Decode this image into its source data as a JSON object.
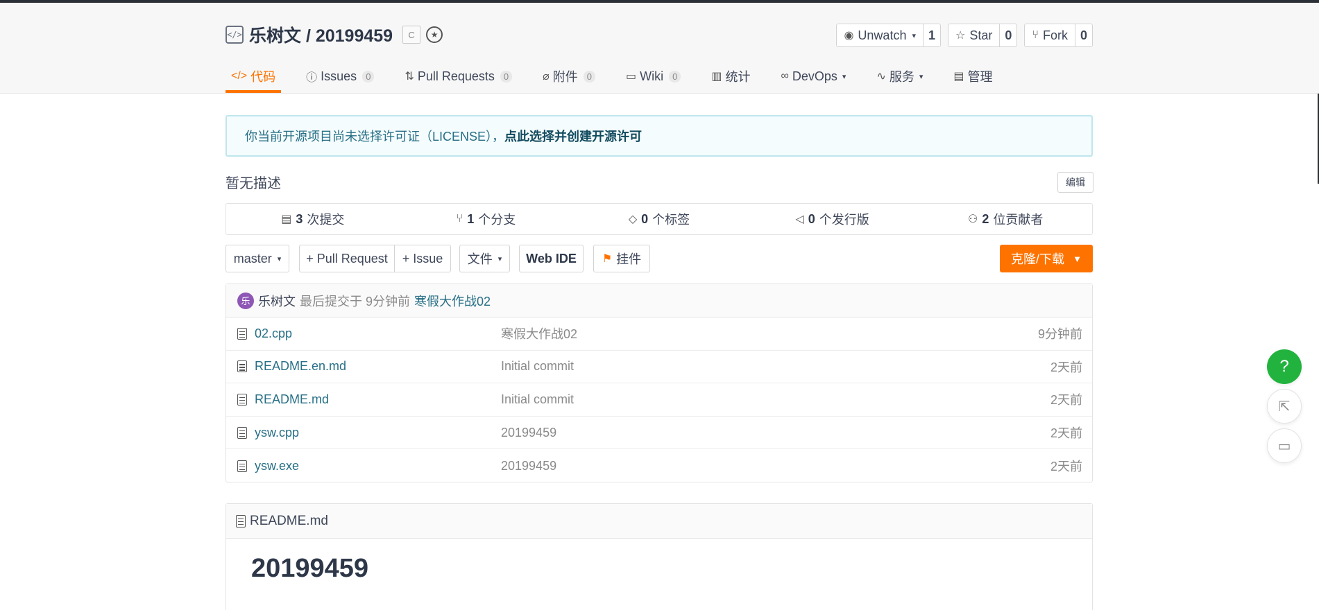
{
  "repo": {
    "owner_slash_name": "乐树文 / 20199459",
    "lang_badge": "C"
  },
  "actions": {
    "unwatch": {
      "label": "Unwatch",
      "count": "1"
    },
    "star": {
      "label": "Star",
      "count": "0"
    },
    "fork": {
      "label": "Fork",
      "count": "0"
    }
  },
  "tabs": [
    {
      "label": "代码"
    },
    {
      "label": "Issues",
      "count": "0"
    },
    {
      "label": "Pull Requests",
      "count": "0"
    },
    {
      "label": "附件",
      "count": "0"
    },
    {
      "label": "Wiki",
      "count": "0"
    },
    {
      "label": "统计"
    },
    {
      "label": "DevOps"
    },
    {
      "label": "服务"
    },
    {
      "label": "管理"
    }
  ],
  "license": {
    "text": "你当前开源项目尚未选择许可证（LICENSE），",
    "link": "点此选择并创建开源许可"
  },
  "description": "暂无描述",
  "edit_label": "编辑",
  "stats": [
    {
      "value": "3",
      "label": "次提交"
    },
    {
      "value": "1",
      "label": "个分支"
    },
    {
      "value": "0",
      "label": "个标签"
    },
    {
      "value": "0",
      "label": "个发行版"
    },
    {
      "value": "2",
      "label": "位贡献者"
    }
  ],
  "toolbar": {
    "branch": "master",
    "pull_request": "+ Pull Request",
    "issue": "+ Issue",
    "file": "文件",
    "web_ide": "Web IDE",
    "widget": "挂件",
    "clone": "克隆/下载"
  },
  "last_commit": {
    "avatar_char": "乐",
    "author": "乐树文",
    "meta": "最后提交于 9分钟前",
    "message": "寒假大作战02"
  },
  "files": [
    {
      "name": "02.cpp",
      "message": "寒假大作战02",
      "time": "9分钟前"
    },
    {
      "name": "README.en.md",
      "message": "Initial commit",
      "time": "2天前"
    },
    {
      "name": "README.md",
      "message": "Initial commit",
      "time": "2天前"
    },
    {
      "name": "ysw.cpp",
      "message": "20199459",
      "time": "2天前"
    },
    {
      "name": "ysw.exe",
      "message": "20199459",
      "time": "2天前"
    }
  ],
  "readme": {
    "filename": "README.md",
    "title": "20199459"
  },
  "floating": {
    "help": "?"
  },
  "colors": {
    "accent": "#fe7300",
    "help_green": "#22b33e",
    "link": "#276f86"
  }
}
